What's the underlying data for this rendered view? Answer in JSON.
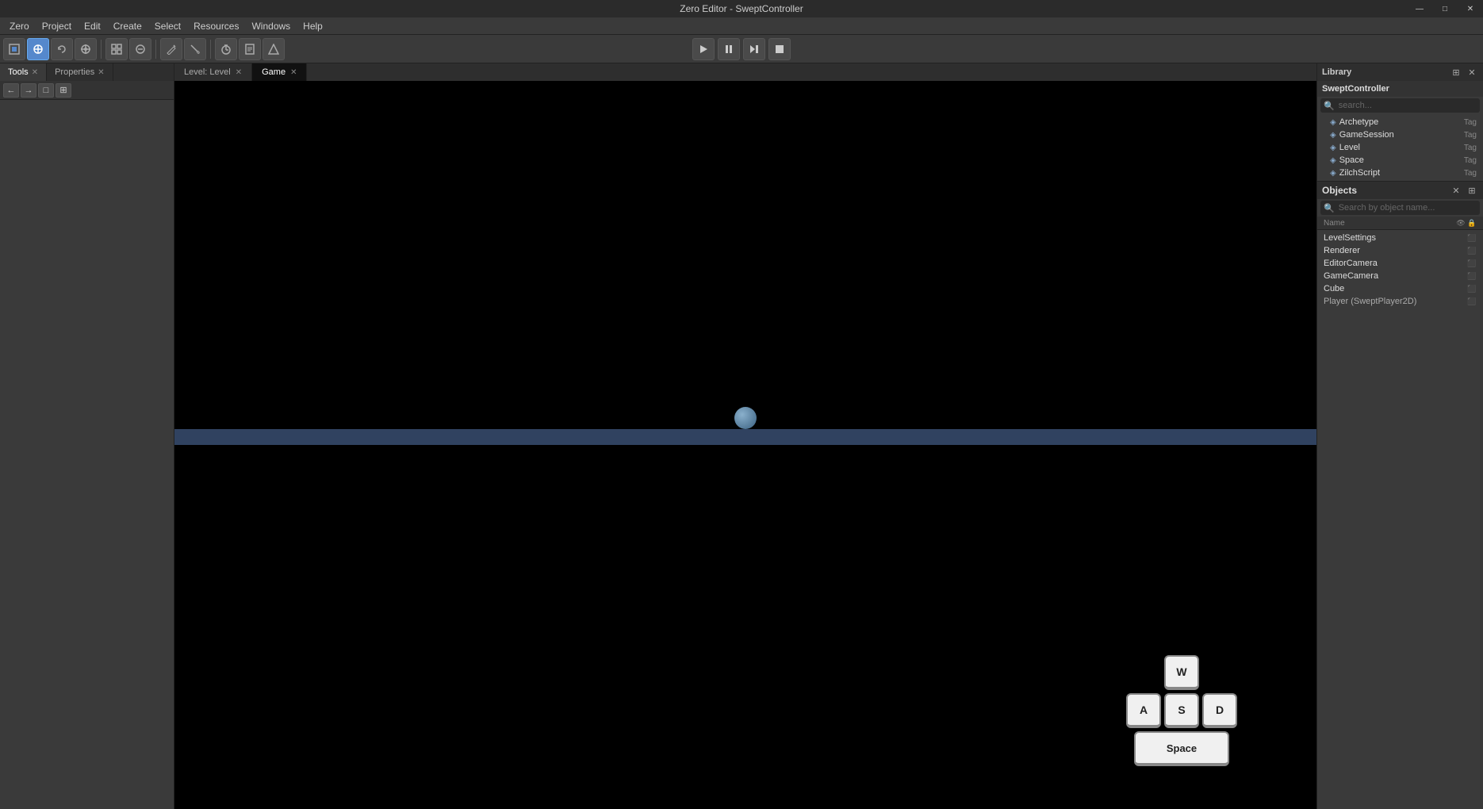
{
  "titleBar": {
    "title": "Zero Editor - SweptController",
    "minimize": "—",
    "maximize": "□",
    "close": "✕"
  },
  "menuBar": {
    "items": [
      "Zero",
      "Project",
      "Edit",
      "Create",
      "Select",
      "Resources",
      "Windows",
      "Help"
    ]
  },
  "toolbar": {
    "buttons": [
      {
        "name": "select-tool",
        "icon": "⊡",
        "active": false
      },
      {
        "name": "translate-tool",
        "icon": "✛",
        "active": true
      },
      {
        "name": "rotate-tool",
        "icon": "↻",
        "active": false
      },
      {
        "name": "scale-tool",
        "icon": "⊕",
        "active": false
      },
      {
        "name": "snap-tool",
        "icon": "⊞",
        "active": false
      },
      {
        "name": "gizmo-tool",
        "icon": "≋",
        "active": false
      },
      {
        "name": "draw-tool",
        "icon": "✏",
        "active": false
      },
      {
        "name": "brush-tool",
        "icon": "⌗",
        "active": false
      },
      {
        "name": "timer-tool",
        "icon": "⏱",
        "active": false
      },
      {
        "name": "script-tool",
        "icon": "◻",
        "active": false
      },
      {
        "name": "arrange-tool",
        "icon": "⊿",
        "active": false
      }
    ],
    "transport": {
      "play": "▶",
      "pause": "⏸",
      "step": "⏭",
      "stop": "⏹"
    }
  },
  "leftPanel": {
    "tabs": [
      {
        "label": "Tools",
        "active": true
      },
      {
        "label": "Properties",
        "active": false
      }
    ],
    "nav": {
      "back": "←",
      "forward": "→",
      "fit": "□",
      "lock": "⊞"
    }
  },
  "centerTabs": [
    {
      "label": "Level: Level",
      "active": false
    },
    {
      "label": "Game",
      "active": true
    }
  ],
  "viewport": {
    "platformColor": "rgba(80,110,160,0.6)"
  },
  "wasd": {
    "w": "W",
    "a": "A",
    "s": "S",
    "d": "D",
    "space": "Space"
  },
  "rightPanel": {
    "library": {
      "title": "Library",
      "closeIcon": "✕",
      "settingsIcon": "⊞",
      "libraryName": "SweptController",
      "searchIcon": "🔍",
      "searchPlaceholder": "search...",
      "items": [
        {
          "name": "Archetype",
          "tag": "Tag"
        },
        {
          "name": "GameSession",
          "tag": "Tag"
        },
        {
          "name": "Level",
          "tag": "Tag"
        },
        {
          "name": "Space",
          "tag": "Tag"
        },
        {
          "name": "ZilchScript",
          "tag": "Tag"
        }
      ]
    },
    "objects": {
      "title": "Objects",
      "closeIcon": "✕",
      "settingsIcon": "⊞",
      "searchPlaceholder": "Search by object name...",
      "columnName": "Name",
      "items": [
        {
          "name": "LevelSettings"
        },
        {
          "name": "Renderer"
        },
        {
          "name": "EditorCamera"
        },
        {
          "name": "GameCamera"
        },
        {
          "name": "Cube"
        },
        {
          "name": "Player (SweptPlayer2D)"
        }
      ]
    }
  }
}
